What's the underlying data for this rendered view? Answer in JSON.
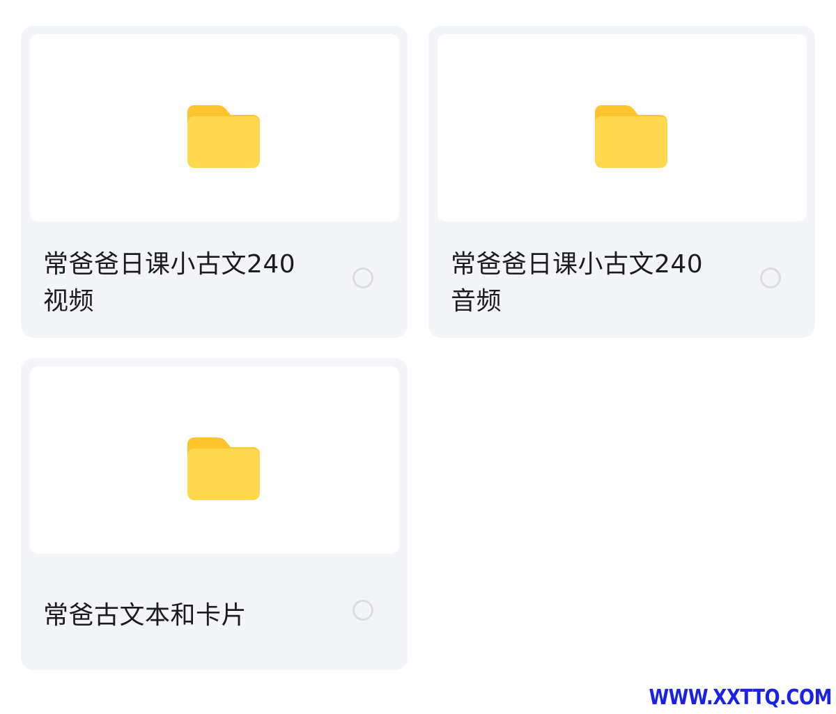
{
  "folders": [
    {
      "name": "常爸爸日课小古文240视频",
      "line1": "常爸爸日课小古文240",
      "line2": "视频",
      "selected": false
    },
    {
      "name": "常爸爸日课小古文240音频",
      "line1": "常爸爸日课小古文240",
      "line2": "音频",
      "selected": false
    },
    {
      "name": "常爸古文本和卡片",
      "line1": "常爸古文本和卡片",
      "line2": "",
      "selected": false
    }
  ],
  "icons": {
    "folder": "folder-icon",
    "select": "radio-unchecked-icon"
  },
  "colors": {
    "card_bg": "#f4f5f9",
    "folder_yellow": "#ffd84d",
    "folder_tab": "#ffc42e",
    "radio_border": "#dcdde2",
    "watermark": "#1b22e6"
  },
  "watermark": "WWW.XXTTQ.COM"
}
